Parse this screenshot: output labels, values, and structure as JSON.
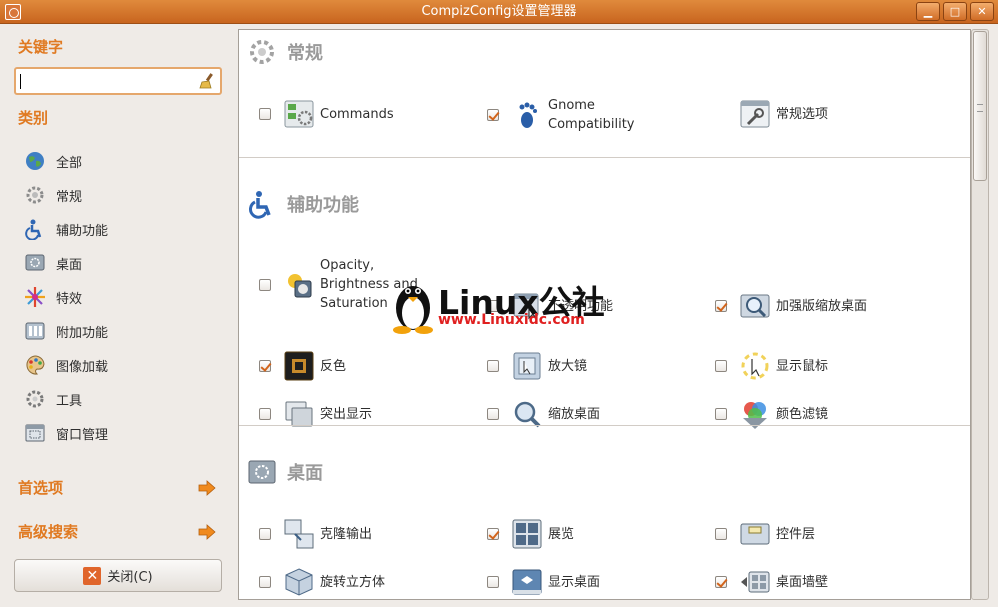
{
  "window": {
    "title": "CompizConfig设置管理器",
    "buttons": [
      "▁",
      "□",
      "✕"
    ]
  },
  "sidebar": {
    "filter_heading": "关键字",
    "search_value": "",
    "category_heading": "类别",
    "categories": [
      {
        "label": "全部",
        "icon": "globe-icon"
      },
      {
        "label": "常规",
        "icon": "gear-icon"
      },
      {
        "label": "辅助功能",
        "icon": "accessibility-icon"
      },
      {
        "label": "桌面",
        "icon": "desktop-icon"
      },
      {
        "label": "特效",
        "icon": "burst-icon"
      },
      {
        "label": "附加功能",
        "icon": "extras-icon"
      },
      {
        "label": "图像加载",
        "icon": "palette-icon"
      },
      {
        "label": "工具",
        "icon": "tools-gear-icon"
      },
      {
        "label": "窗口管理",
        "icon": "window-icon"
      }
    ],
    "preferences_label": "首选项",
    "advanced_search_label": "高级搜索",
    "close_button_label": "关闭(C)"
  },
  "sections": [
    {
      "title": "常规",
      "plugins": [
        {
          "label": "Commands",
          "checked": false
        },
        {
          "label": "Gnome\nCompatibility",
          "checked": true
        },
        {
          "label": "常规选项",
          "checked": false
        }
      ]
    },
    {
      "title": "辅助功能",
      "plugins": [
        {
          "label": "Opacity,\nBrightness and\nSaturation",
          "checked": false
        },
        {
          "label": "不透明功能",
          "checked": false
        },
        {
          "label": "加强版缩放桌面",
          "checked": true
        },
        {
          "label": "反色",
          "checked": true
        },
        {
          "label": "放大镜",
          "checked": false
        },
        {
          "label": "显示鼠标",
          "checked": false
        },
        {
          "label": "突出显示",
          "checked": false
        },
        {
          "label": "缩放桌面",
          "checked": false
        },
        {
          "label": "颜色滤镜",
          "checked": false
        }
      ]
    },
    {
      "title": "桌面",
      "plugins": [
        {
          "label": "克隆输出",
          "checked": false
        },
        {
          "label": "展览",
          "checked": true
        },
        {
          "label": "控件层",
          "checked": false
        },
        {
          "label": "旋转立方体",
          "checked": false
        },
        {
          "label": "显示桌面",
          "checked": false
        },
        {
          "label": "桌面墙壁",
          "checked": true
        }
      ]
    }
  ],
  "watermark": {
    "main": "Linux公社",
    "sub": "www.Linuxidc.com"
  },
  "colors": {
    "accent": "#e07a22",
    "titlebar": "#d8731f",
    "check": "#d2641b"
  }
}
